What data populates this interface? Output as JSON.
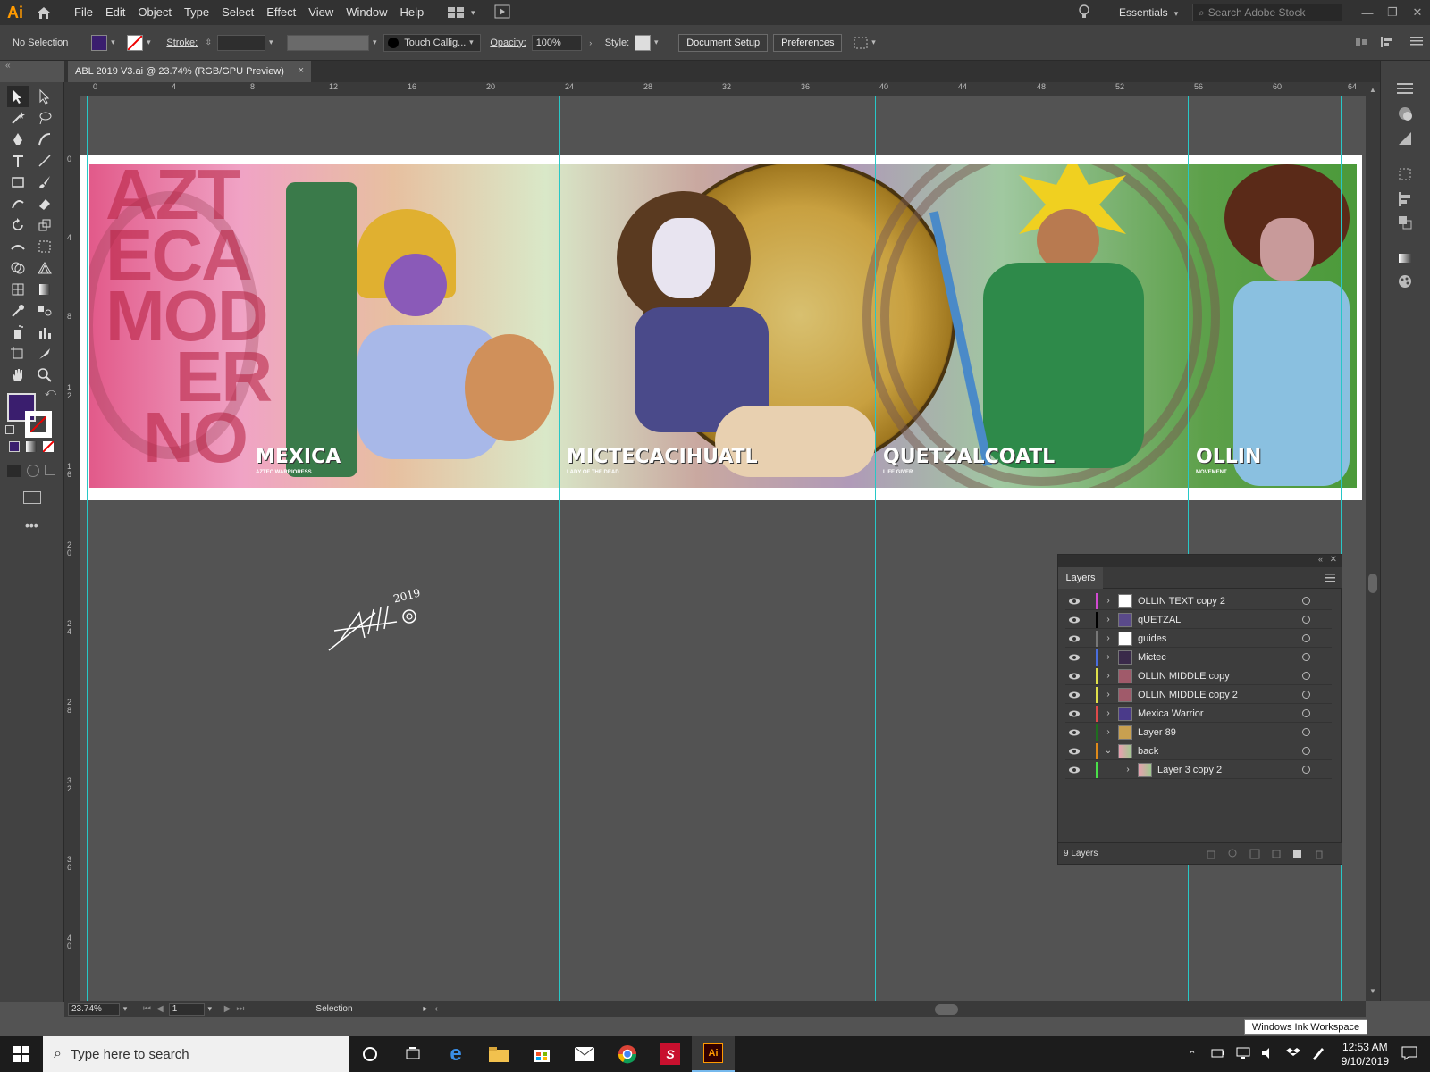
{
  "app": {
    "logo": "Ai"
  },
  "menu": [
    "File",
    "Edit",
    "Object",
    "Type",
    "Select",
    "Effect",
    "View",
    "Window",
    "Help"
  ],
  "menubar_right": {
    "workspace": "Essentials",
    "stock_placeholder": "Search Adobe Stock"
  },
  "control": {
    "selection": "No Selection",
    "stroke_label": "Stroke:",
    "brush": "Touch Callig...",
    "opacity_label": "Opacity:",
    "opacity_value": "100%",
    "style_label": "Style:",
    "doc_setup": "Document Setup",
    "preferences": "Preferences"
  },
  "colors": {
    "fill": "#3a1e6e",
    "accent": "#27c7c7"
  },
  "doc_tab": {
    "title": "ABL 2019 V3.ai @ 23.74% (RGB/GPU Preview)",
    "close": "×"
  },
  "ruler_h": [
    "0",
    "4",
    "8",
    "12",
    "16",
    "20",
    "24",
    "28",
    "32",
    "36",
    "40",
    "44",
    "48",
    "52",
    "56",
    "60",
    "64"
  ],
  "ruler_v": [
    "0",
    "4",
    "8",
    "1\n2",
    "1\n6",
    "2\n0",
    "2\n4",
    "2\n8",
    "3\n2",
    "3\n6",
    "4\n0"
  ],
  "art": {
    "big_words": [
      "AZT",
      "ECA",
      "MOD",
      "ER",
      "NO"
    ],
    "characters": [
      {
        "title": "MEXICA",
        "subtitle": "AZTEC WARRIORESS"
      },
      {
        "title": "MICTECACIHUATL",
        "subtitle": "LADY OF THE DEAD"
      },
      {
        "title": "QUETZALCOATL",
        "subtitle": "LIFE GIVER"
      },
      {
        "title": "OLLIN",
        "subtitle": "MOVEMENT"
      }
    ],
    "signature_year": "2019"
  },
  "layers": {
    "tab": "Layers",
    "rows": [
      {
        "name": "OLLIN TEXT copy 2",
        "color": "#d24ad2"
      },
      {
        "name": "qUETZAL",
        "color": "#000000"
      },
      {
        "name": "guides",
        "color": "#777777"
      },
      {
        "name": "Mictec",
        "color": "#4a6ee0"
      },
      {
        "name": "OLLIN MIDDLE copy",
        "color": "#e0e04a"
      },
      {
        "name": "OLLIN MIDDLE copy 2",
        "color": "#e0e04a"
      },
      {
        "name": "Mexica Warrior",
        "color": "#e04a4a"
      },
      {
        "name": "Layer 89",
        "color": "#1f6e1f"
      },
      {
        "name": "back",
        "color": "#e08a1a"
      },
      {
        "name": "Layer 3 copy 2",
        "color": "#4ae04a"
      }
    ],
    "count": "9 Layers"
  },
  "status": {
    "zoom": "23.74%",
    "page": "1",
    "tool": "Selection"
  },
  "tooltip": "Windows Ink Workspace",
  "taskbar": {
    "search": "Type here to search",
    "time": "12:53 AM",
    "date": "9/10/2019"
  }
}
